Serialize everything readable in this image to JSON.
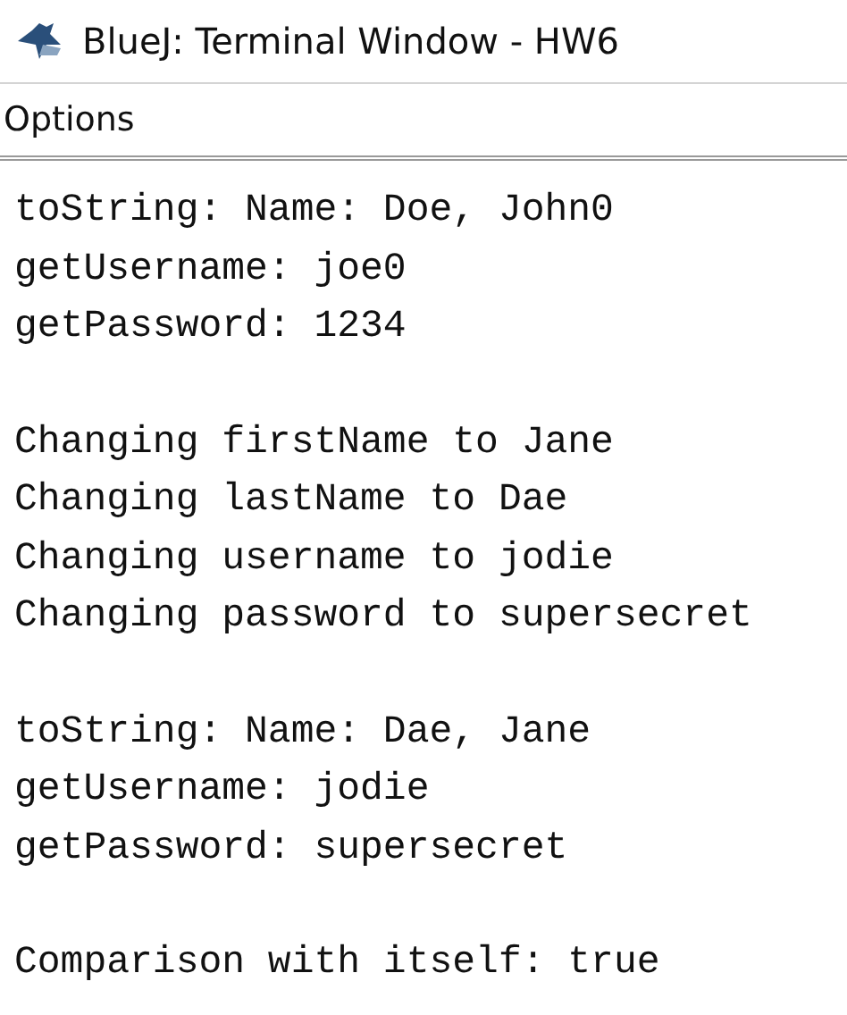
{
  "window": {
    "title": "BlueJ: Terminal Window - HW6"
  },
  "menu": [
    "Options"
  ],
  "terminal": {
    "blocks": [
      [
        "toString: Name: Doe, John0",
        "getUsername: joe0",
        "getPassword: 1234"
      ],
      [
        "Changing firstName to Jane",
        "Changing lastName to Dae",
        "Changing username to jodie",
        "Changing password to supersecret"
      ],
      [
        "toString: Name: Dae, Jane",
        "getUsername: jodie",
        "getPassword: supersecret"
      ],
      [
        "Comparison with itself: true"
      ]
    ]
  }
}
